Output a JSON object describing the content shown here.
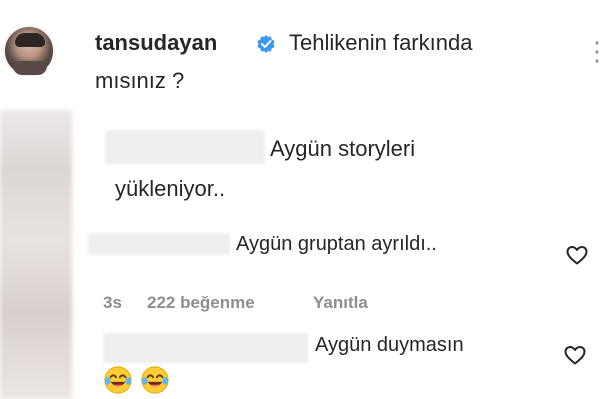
{
  "post": {
    "username": "tansudayan",
    "caption_line1": "Tehlikenin farkında",
    "caption_line2": "mısınız ?"
  },
  "comments": [
    {
      "text_line1": "Aygün storyleri",
      "text_line2": "yükleniyor.."
    },
    {
      "text": "Aygün gruptan ayrıldı.."
    },
    {
      "text": "Aygün duymasın"
    }
  ],
  "meta": {
    "time": "3s",
    "likes": "222 beğenme",
    "reply": "Yanıtla"
  },
  "colors": {
    "text": "#262626",
    "secondary": "#8e8e8e",
    "verified": "#3897f0"
  },
  "icons": {
    "verified": "verified-badge-icon",
    "like": "heart-outline-icon",
    "emoji": "face-with-tears-of-joy-emoji"
  }
}
